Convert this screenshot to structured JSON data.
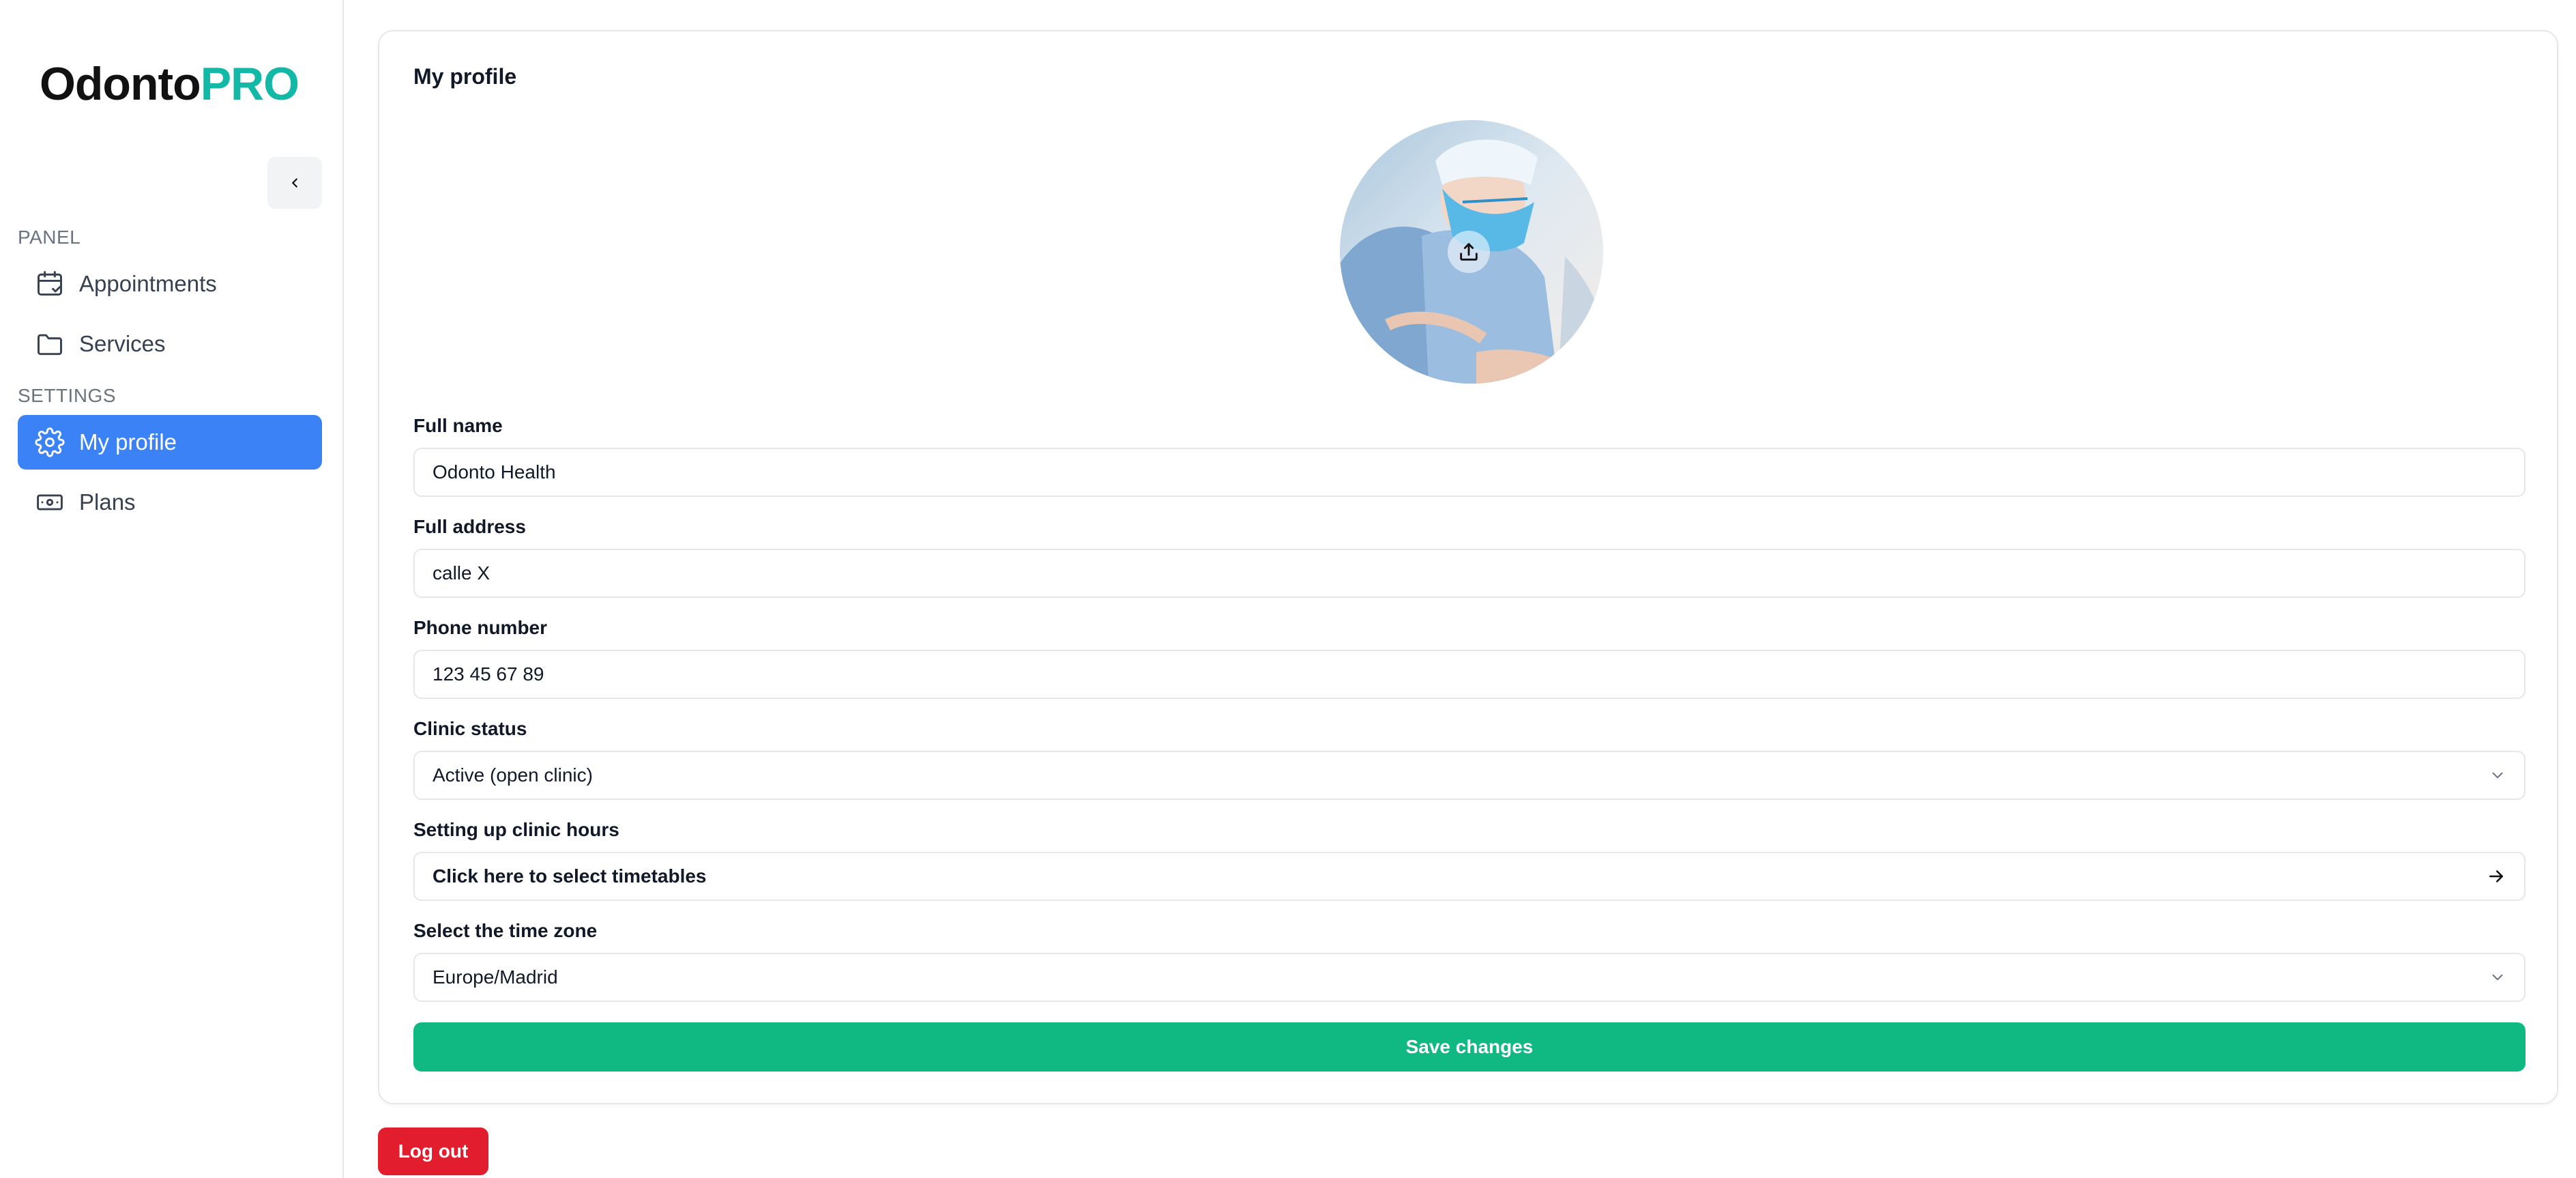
{
  "brand": {
    "name_part1": "Odonto",
    "name_part2": "PRO",
    "accent_color": "#14b8a6"
  },
  "sidebar": {
    "collapse_icon": "chevron-left-icon",
    "sections": [
      {
        "label": "PANEL"
      },
      {
        "label": "SETTINGS"
      }
    ],
    "items": [
      {
        "label": "Appointments",
        "icon": "calendar-check-icon",
        "active": false
      },
      {
        "label": "Services",
        "icon": "folder-icon",
        "active": false
      },
      {
        "label": "My profile",
        "icon": "gear-icon",
        "active": true
      },
      {
        "label": "Plans",
        "icon": "banknote-icon",
        "active": false
      }
    ],
    "active_color": "#3b82f6"
  },
  "profile": {
    "title": "My profile",
    "upload_icon": "upload-icon",
    "fields": {
      "full_name": {
        "label": "Full name",
        "value": "Odonto Health"
      },
      "full_address": {
        "label": "Full address",
        "value": "calle X"
      },
      "phone": {
        "label": "Phone number",
        "value": "123 45 67 89"
      },
      "clinic_status": {
        "label": "Clinic status",
        "value": "Active (open clinic)"
      },
      "hours": {
        "label": "Setting up clinic hours",
        "value": "Click here to select timetables"
      },
      "timezone": {
        "label": "Select the time zone",
        "value": "Europe/Madrid"
      }
    },
    "save_label": "Save changes",
    "save_color": "#10b981"
  },
  "logout_label": "Log out",
  "logout_color": "#e11d2e"
}
